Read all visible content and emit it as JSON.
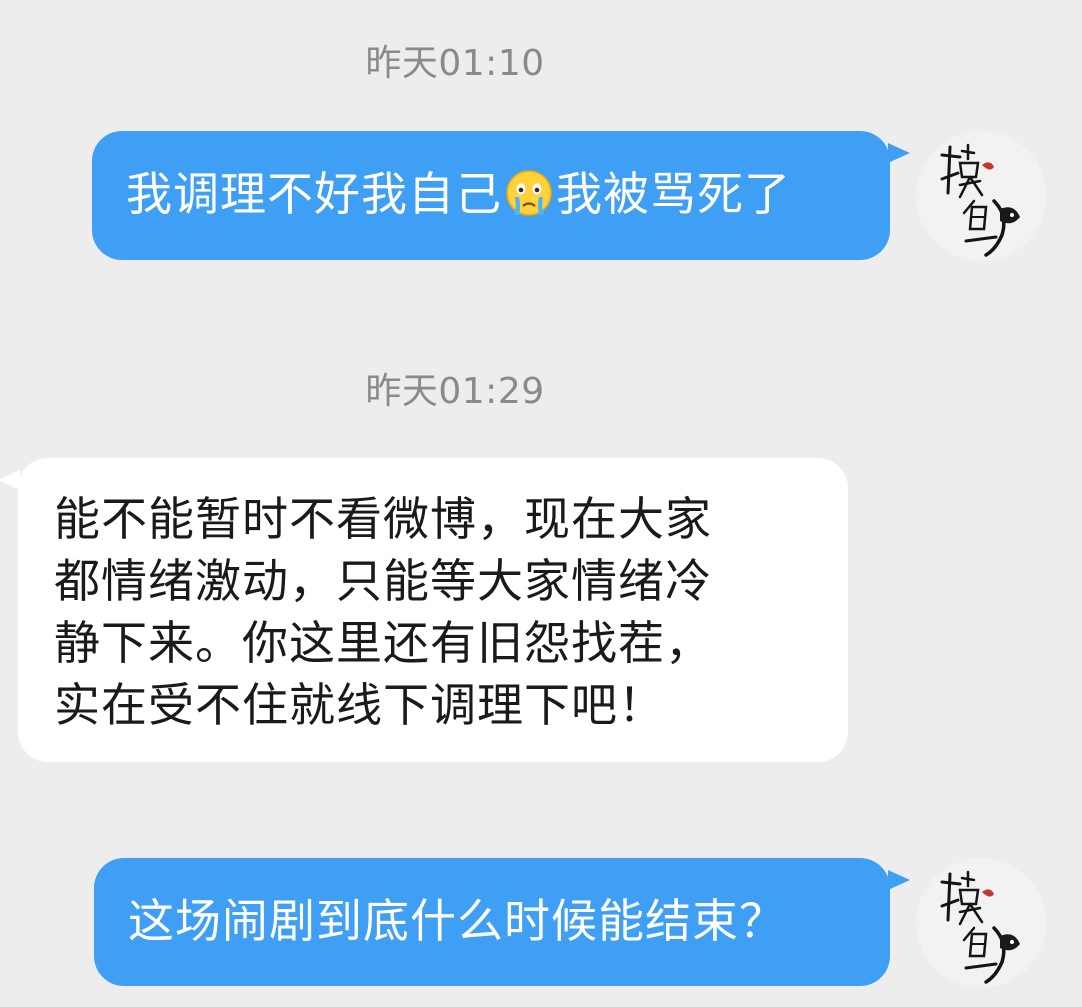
{
  "messages": [
    {
      "timestamp": "昨天01:10",
      "text_before": "我调理不好我自己",
      "emoji": "loudly-crying-face-emoji",
      "text_after": "我被骂死了"
    },
    {
      "timestamp": "昨天01:29",
      "lines": [
        "能不能暂时不看微博，现在大家",
        "都情绪激动，只能等大家情绪冷",
        "静下来。你这里还有旧怨找茬，",
        "实在受不住就线下调理下吧！"
      ]
    },
    {
      "text": "这场闹剧到底什么时候能结束？"
    }
  ],
  "colors": {
    "background": "#ededed",
    "outgoing_bubble": "#3f9ff5",
    "incoming_bubble": "#ffffff",
    "timestamp_text": "#8a8a8a"
  },
  "avatar": {
    "icon": "ink-calligraphy-fish-avatar"
  }
}
